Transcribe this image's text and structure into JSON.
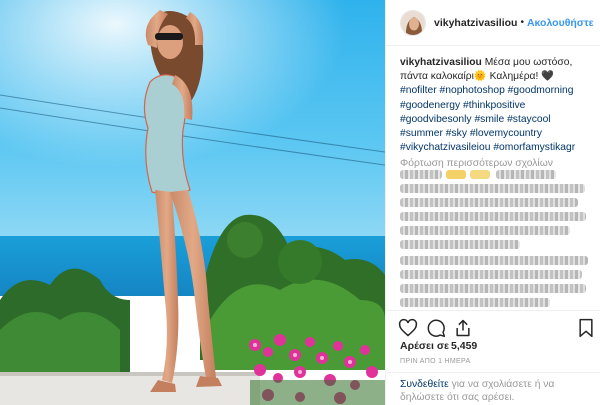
{
  "post": {
    "username": "vikyhatzivasiliou",
    "separator": "•",
    "follow_label": "Ακολουθήστε"
  },
  "caption": {
    "username": "vikyhatzivasiliou",
    "text": "Μέσα μου ωστόσο, πάντα καλοκαίρι",
    "emoji_sun": "🌞",
    "text2": "Καλημέρα!",
    "heart": "🖤",
    "hashtags": [
      "#nofilter",
      "#nophotoshop",
      "#goodmorning",
      "#goodenergy",
      "#thinkpositive",
      "#goodvibesonly",
      "#smile",
      "#staycool",
      "#summer",
      "#sky",
      "#lovemycountry",
      "#vikychatzivasileiou",
      "#omorfamystikagr"
    ]
  },
  "load_more_label": "Φόρτωση περισσότερων σχολίων",
  "likes": {
    "label": "Αρέσει σε",
    "count": "5,459"
  },
  "timestamp": "ΠΡΙΝ ΑΠΟ 1 ΗΜΕΡΑ",
  "login_prompt": {
    "link": "Συνδεθείτε",
    "text": "για να σχολιάσετε ή να δηλώσετε ότι σας αρέσει."
  },
  "colors": {
    "link_blue": "#3897f0",
    "hashtag_blue": "#003569",
    "muted": "#999999",
    "text": "#262626"
  },
  "icons": [
    "heart-icon",
    "comment-icon",
    "share-icon",
    "bookmark-icon"
  ]
}
